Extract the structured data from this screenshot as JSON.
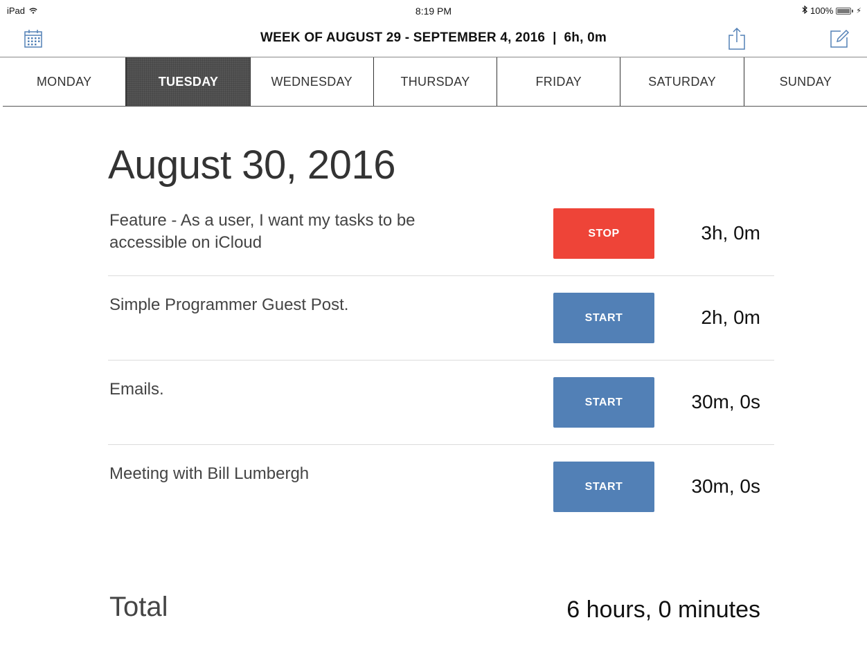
{
  "status_bar": {
    "device": "iPad",
    "time": "8:19 PM",
    "battery_text": "100%"
  },
  "nav": {
    "title": "WEEK OF AUGUST 29 - SEPTEMBER 4, 2016  |  6h, 0m",
    "left_icon": "calendar-icon",
    "right_icons": [
      "share-icon",
      "compose-icon"
    ]
  },
  "tabs": [
    {
      "label": "MONDAY",
      "selected": false
    },
    {
      "label": "TUESDAY",
      "selected": true
    },
    {
      "label": "WEDNESDAY",
      "selected": false
    },
    {
      "label": "THURSDAY",
      "selected": false
    },
    {
      "label": "FRIDAY",
      "selected": false
    },
    {
      "label": "SATURDAY",
      "selected": false
    },
    {
      "label": "SUNDAY",
      "selected": false
    }
  ],
  "date_heading": "August 30, 2016",
  "tasks": [
    {
      "name": "Feature - As a user, I want my tasks to be accessible on iCloud",
      "button": "STOP",
      "time": "3h, 0m"
    },
    {
      "name": "Simple Programmer Guest Post.",
      "button": "START",
      "time": "2h, 0m"
    },
    {
      "name": "Emails.",
      "button": "START",
      "time": "30m, 0s"
    },
    {
      "name": "Meeting with Bill Lumbergh",
      "button": "START",
      "time": "30m, 0s"
    }
  ],
  "total": {
    "label": "Total",
    "value": "6 hours, 0 minutes"
  },
  "colors": {
    "stop_button": "#ee4438",
    "start_button": "#5280b6",
    "selected_tab": "#555555"
  }
}
